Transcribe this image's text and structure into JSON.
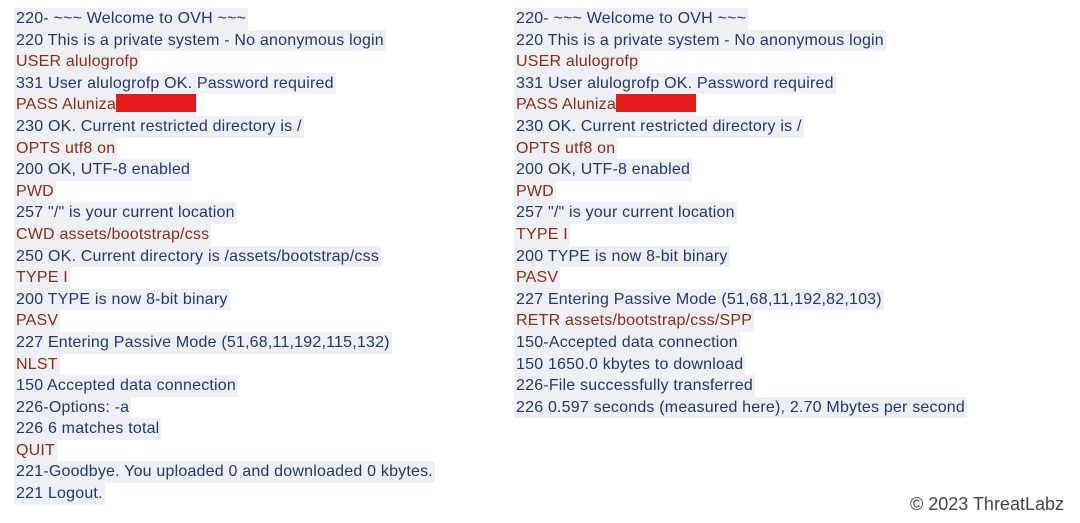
{
  "copyright": "© 2023 ThreatLabz",
  "left": {
    "l0": "220-  ~~~ Welcome to OVH ~~~",
    "l1": "220 This is a private system - No anonymous login",
    "l2": "USER alulogrofp",
    "l3": "331 User alulogrofp OK. Password required",
    "l4_prefix": "PASS Aluniza",
    "l5": "230 OK. Current restricted directory is /",
    "l6": "OPTS utf8 on",
    "l7": "200 OK, UTF-8 enabled",
    "l8": "PWD",
    "l9": "257 \"/\" is your current location",
    "l10": "CWD assets/bootstrap/css",
    "l11": "250 OK. Current directory is /assets/bootstrap/css",
    "l12": "TYPE I",
    "l13": "200 TYPE is now 8-bit binary",
    "l14": "PASV",
    "l15": "227 Entering Passive Mode (51,68,11,192,115,132)",
    "l16": "NLST",
    "l17": "150 Accepted data connection",
    "l18": "226-Options: -a",
    "l19": "226 6 matches total",
    "l20": "QUIT",
    "l21": "221-Goodbye. You uploaded 0 and downloaded 0 kbytes.",
    "l22": "221 Logout."
  },
  "right": {
    "l0": "220-  ~~~ Welcome to OVH ~~~",
    "l1": "220 This is a private system - No anonymous login",
    "l2": "USER alulogrofp",
    "l3": "331 User alulogrofp OK. Password required",
    "l4_prefix": "PASS Aluniza",
    "l5": "230 OK. Current restricted directory is /",
    "l6": "OPTS utf8 on",
    "l7": "200 OK, UTF-8 enabled",
    "l8": "PWD",
    "l9": "257 \"/\" is your current location",
    "l10": "TYPE I",
    "l11": "200 TYPE is now 8-bit binary",
    "l12": "PASV",
    "l13": "227 Entering Passive Mode (51,68,11,192,82,103)",
    "l14": "RETR assets/bootstrap/css/SPP",
    "l15": "150-Accepted data connection",
    "l16": "150 1650.0 kbytes to download",
    "l17": "226-File successfully transferred",
    "l18": "226 0.597 seconds (measured here), 2.70 Mbytes per second"
  }
}
